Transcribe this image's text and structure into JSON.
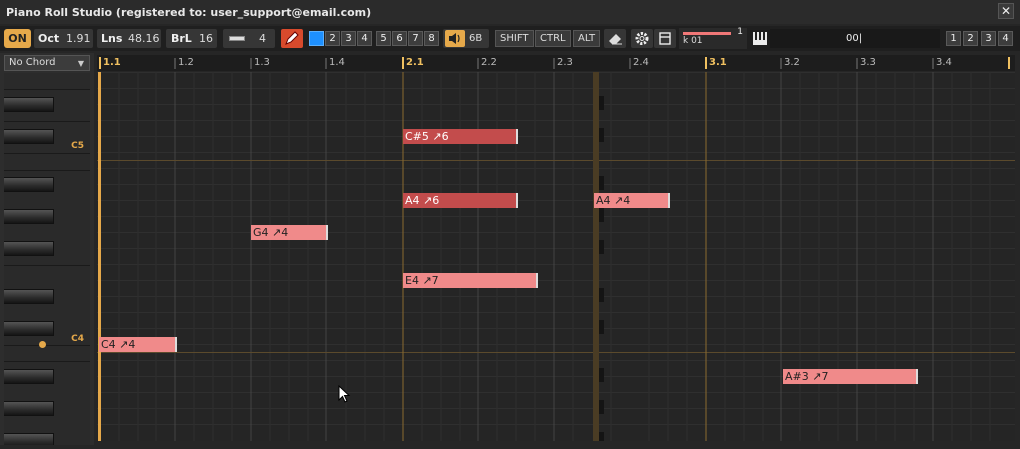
{
  "window": {
    "title": "Piano Roll Studio  (registered to: user_support@email.com)",
    "close_icon": "close-icon"
  },
  "toolbar": {
    "on_label": "ON",
    "oct_label": "Oct",
    "oct_value": "1.91",
    "lns_label": "Lns",
    "lns_value": "48.16",
    "brl_label": "BrL",
    "brl_value": "16",
    "quant_value": "4",
    "layers": [
      "2",
      "3",
      "4",
      "5",
      "6",
      "7",
      "8"
    ],
    "volume_value": "6B",
    "modifiers": [
      "SHIFT",
      "CTRL",
      "ALT"
    ],
    "track_num": "1",
    "track_name": "k 01",
    "field_value": "00|",
    "views": [
      "1",
      "2",
      "3",
      "4"
    ],
    "colors": {
      "accent": "#e6a94a",
      "pencil": "#d84a2c",
      "layer_active": "#1e90ff"
    }
  },
  "chord_select": {
    "value": "No Chord"
  },
  "keyboard": {
    "labels": [
      "C5",
      "C4"
    ]
  },
  "ruler": {
    "labels": [
      "1.1",
      "1.2",
      "1.3",
      "1.4",
      "2.1",
      "2.2",
      "2.3",
      "2.4",
      "3.1",
      "3.2",
      "3.3",
      "3.4"
    ]
  },
  "notes": [
    {
      "text": "C#5 ↗6",
      "style": "dark"
    },
    {
      "text": "A4 ↗6",
      "style": "dark"
    },
    {
      "text": "A4 ↗4",
      "style": "light"
    },
    {
      "text": "G4 ↗4",
      "style": "light"
    },
    {
      "text": "E4 ↗7",
      "style": "light"
    },
    {
      "text": "C4 ↗4",
      "style": "light"
    },
    {
      "text": "A#3 ↗7",
      "style": "light"
    }
  ]
}
